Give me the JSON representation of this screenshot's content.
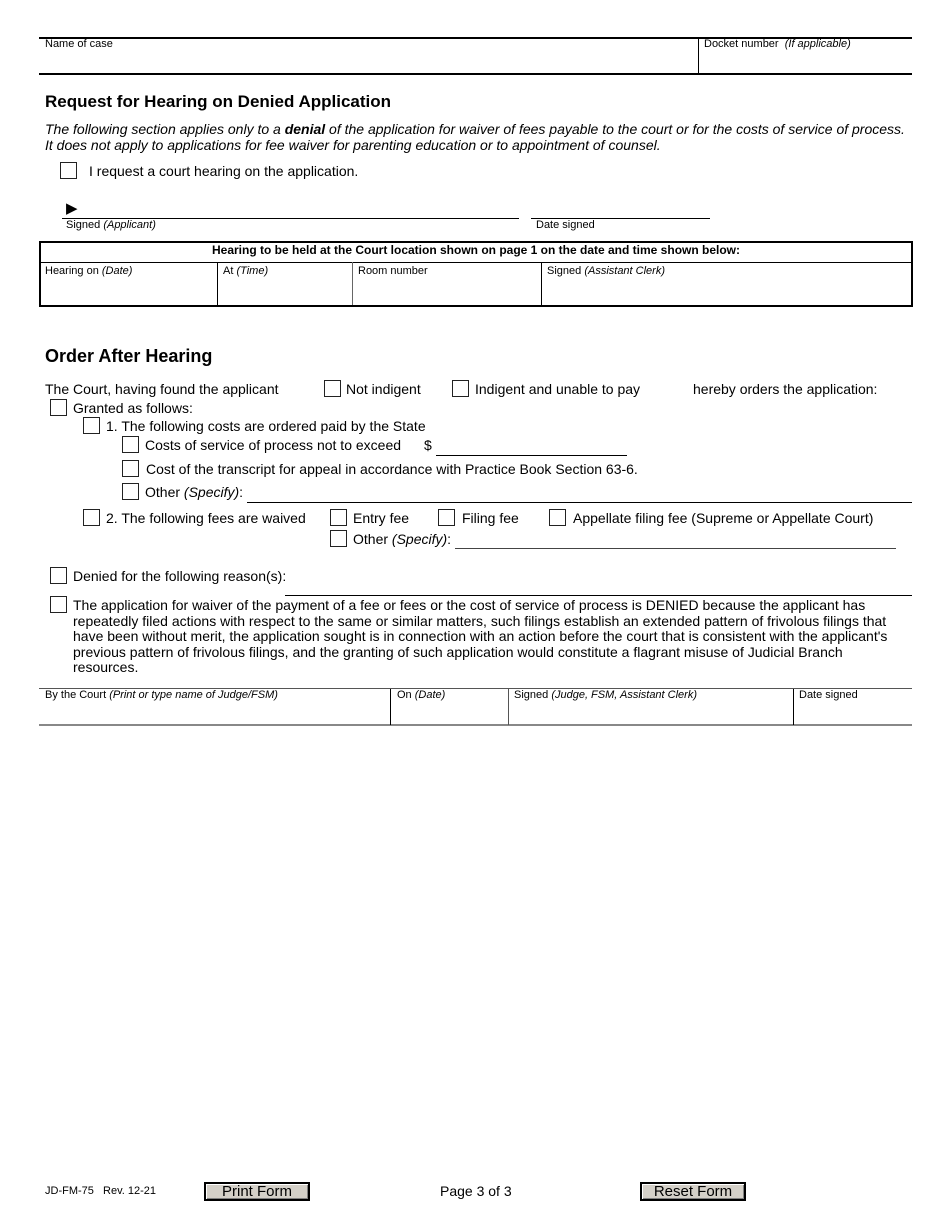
{
  "header": {
    "name_of_case_label": "Name of case",
    "docket_label": "Docket number",
    "docket_hint": "(If applicable)"
  },
  "request_section": {
    "title": "Request for Hearing on Denied Application",
    "intro_part1": "The following section applies only to a ",
    "intro_bold": "denial",
    "intro_part2": " of the application for waiver of fees payable to the court or for the costs of service of process.",
    "intro_line2": "It does not apply to applications for fee waiver for parenting education or to appointment of counsel.",
    "request_checkbox_label": "I request a court hearing on the application.",
    "signed_label": "Signed ",
    "signed_hint": "(Applicant)",
    "date_signed_label": "Date signed",
    "signature_arrow": "▶"
  },
  "hearing_box": {
    "title": "Hearing to be held at the Court location shown on page 1 on the date and time shown below:",
    "hearing_on_label": "Hearing on ",
    "hearing_on_hint": "(Date)",
    "at_label": "At ",
    "at_hint": "(Time)",
    "room_label": "Room number",
    "signed_label": "Signed ",
    "signed_hint": "(Assistant Clerk)"
  },
  "order_section": {
    "title": "Order After Hearing",
    "court_found": "The Court, having found the applicant",
    "not_indigent": "Not indigent",
    "indigent": "Indigent and unable to pay",
    "hereby_orders": "hereby orders the application:",
    "granted": "Granted as follows:",
    "item1": "1. The following costs are ordered paid by the State",
    "costs_service": "Costs of service of process not to exceed",
    "dollar": "$",
    "transcript": "Cost of the transcript for appeal in accordance with Practice Book Section 63-6.",
    "other_label": "Other ",
    "other_hint": "(Specify)",
    "colon": ":",
    "item2": "2. The following fees are waived",
    "entry_fee": "Entry fee",
    "filing_fee": "Filing fee",
    "appellate_fee": "Appellate filing fee (Supreme or Appellate Court)",
    "denied": "Denied for the following reason(s):",
    "denied_frivolous": "The application for waiver of the payment of a fee or fees or the cost of service of process is DENIED because the applicant has repeatedly filed actions with respect to the same or similar matters, such filings establish an extended pattern of frivolous filings that have been without merit, the application sought is in connection with an action before the court that is consistent with the applicant's previous pattern of frivolous filings, and the granting of such application would constitute a flagrant misuse of Judicial Branch resources."
  },
  "signature_row": {
    "by_court_label": "By the Court ",
    "by_court_hint": "(Print or type name of Judge/FSM)",
    "on_label": "On ",
    "on_hint": "(Date)",
    "signed_label": "Signed ",
    "signed_hint": "(Judge, FSM, Assistant Clerk)",
    "date_signed_label": "Date signed"
  },
  "footer": {
    "form_id": "JD-FM-75   Rev. 12-21",
    "print_button": "Print Form",
    "page": "Page 3 of 3",
    "reset_button": "Reset Form"
  }
}
